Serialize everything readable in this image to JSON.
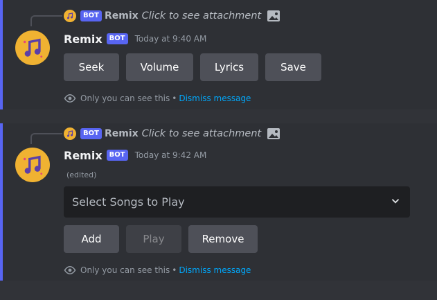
{
  "messages": [
    {
      "reply": {
        "author": "Remix",
        "bot_tag": "BOT",
        "text": "Click to see attachment",
        "icon": "image-icon"
      },
      "author": "Remix",
      "bot_tag": "BOT",
      "timestamp": "Today at 9:40 AM",
      "buttons": [
        {
          "label": "Seek"
        },
        {
          "label": "Volume"
        },
        {
          "label": "Lyrics"
        },
        {
          "label": "Save"
        }
      ],
      "ephemeral": {
        "text": "Only you can see this",
        "separator": "•",
        "dismiss": "Dismiss message"
      }
    },
    {
      "reply": {
        "author": "Remix",
        "bot_tag": "BOT",
        "text": "Click to see attachment",
        "icon": "image-icon"
      },
      "author": "Remix",
      "bot_tag": "BOT",
      "timestamp": "Today at 9:42 AM",
      "edited": "(edited)",
      "select": {
        "placeholder": "Select Songs to Play"
      },
      "buttons": [
        {
          "label": "Add",
          "disabled": false
        },
        {
          "label": "Play",
          "disabled": true
        },
        {
          "label": "Remove",
          "disabled": false
        }
      ],
      "ephemeral": {
        "text": "Only you can see this",
        "separator": "•",
        "dismiss": "Dismiss message"
      }
    }
  ],
  "colors": {
    "accent": "#5865f2",
    "avatar": "#f0b232",
    "button": "#4e5058",
    "link": "#00a8fc"
  }
}
